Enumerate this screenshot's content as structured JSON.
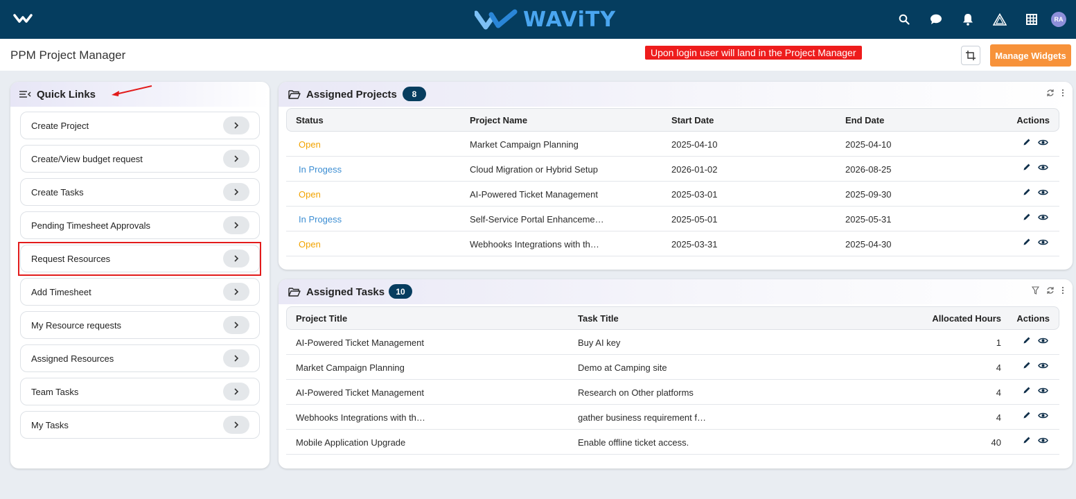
{
  "app": {
    "brand": "WAViTY",
    "user_initials": "RA",
    "icons": [
      "menu-logo-icon",
      "search-icon",
      "chat-icon",
      "bell-icon",
      "warning-icon",
      "grid-icon"
    ]
  },
  "header": {
    "title": "PPM Project Manager",
    "notice": "Upon login user will land in the Project Manager",
    "manage_widgets": "Manage Widgets"
  },
  "quick_links": {
    "title": "Quick Links",
    "items": [
      {
        "label": "Create Project"
      },
      {
        "label": "Create/View budget request"
      },
      {
        "label": "Create Tasks"
      },
      {
        "label": "Pending Timesheet Approvals"
      },
      {
        "label": "Request Resources"
      },
      {
        "label": "Add Timesheet"
      },
      {
        "label": "My Resource requests"
      },
      {
        "label": "Assigned Resources"
      },
      {
        "label": "Team Tasks"
      },
      {
        "label": "My Tasks"
      }
    ]
  },
  "assigned_projects": {
    "title": "Assigned Projects",
    "count": "8",
    "columns": {
      "status": "Status",
      "name": "Project Name",
      "start": "Start Date",
      "end": "End Date",
      "actions": "Actions"
    },
    "rows": [
      {
        "status": "Open",
        "name": "Market Campaign Planning",
        "start": "2025-04-10",
        "end": "2025-04-10"
      },
      {
        "status": "In Progess",
        "name": "Cloud Migration or Hybrid Setup",
        "start": "2026-01-02",
        "end": "2026-08-25"
      },
      {
        "status": "Open",
        "name": "AI-Powered Ticket Management",
        "start": "2025-03-01",
        "end": "2025-09-30"
      },
      {
        "status": "In Progess",
        "name": "Self-Service Portal Enhanceme…",
        "start": "2025-05-01",
        "end": "2025-05-31"
      },
      {
        "status": "Open",
        "name": "Webhooks Integrations with th…",
        "start": "2025-03-31",
        "end": "2025-04-30"
      }
    ]
  },
  "assigned_tasks": {
    "title": "Assigned Tasks",
    "count": "10",
    "columns": {
      "project": "Project Title",
      "task": "Task Title",
      "hours": "Allocated Hours",
      "actions": "Actions"
    },
    "rows": [
      {
        "project": "AI-Powered Ticket Management",
        "task": "Buy AI key",
        "hours": "1"
      },
      {
        "project": "Market Campaign Planning",
        "task": "Demo at Camping site",
        "hours": "4"
      },
      {
        "project": "AI-Powered Ticket Management",
        "task": "Research on Other platforms",
        "hours": "4"
      },
      {
        "project": "Webhooks Integrations with th…",
        "task": "gather business requirement f…",
        "hours": "4"
      },
      {
        "project": "Mobile Application Upgrade",
        "task": "Enable offline ticket access.",
        "hours": "40"
      }
    ]
  },
  "colors": {
    "topbar": "#053d5f",
    "accent_orange": "#f7923a",
    "status_open": "#f2a300",
    "status_in_progress": "#3c8ed3",
    "notice_red": "#ee1c1c"
  }
}
